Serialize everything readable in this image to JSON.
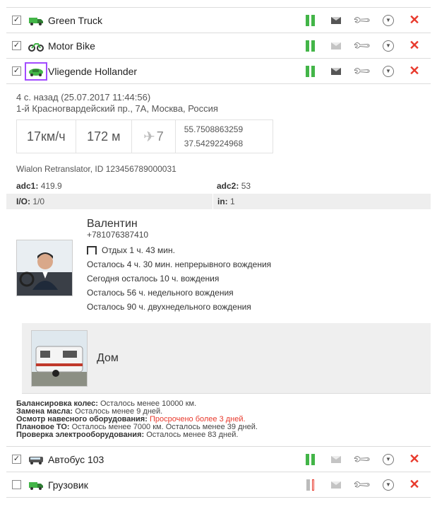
{
  "units": [
    {
      "name": "Green Truck",
      "checked": true,
      "icon": "truck-icon",
      "connection": "online"
    },
    {
      "name": "Motor Bike",
      "checked": true,
      "icon": "motorbike-icon",
      "connection": "online"
    },
    {
      "name": "Vliegende Hollander",
      "checked": true,
      "icon": "car-icon",
      "connection": "online"
    },
    {
      "name": "Автобус 103",
      "checked": true,
      "icon": "bus-icon",
      "connection": "online"
    },
    {
      "name": "Грузовик",
      "checked": false,
      "icon": "truck-icon",
      "connection": "offline"
    }
  ],
  "checkbox_mark": "✓",
  "details": {
    "last_message": "4 с. назад (25.07.2017 11:44:56)",
    "address": "1-й Красногвардейский пр., 7А, Москва, Россия",
    "speed": "17км/ч",
    "altitude": "172 м",
    "satellites": "7",
    "lat": "55.7508863259",
    "lon": "37.5429224968",
    "hardware": "Wialon Retranslator, ID 123456789000031",
    "params": [
      {
        "k1": "adc1:",
        "v1": "419.9",
        "k2": "adc2:",
        "v2": "53"
      },
      {
        "k1": "I/O:",
        "v1": "1/0",
        "k2": "in:",
        "v2": "1"
      }
    ]
  },
  "driver": {
    "name": "Валентин",
    "phone": "+781076387410",
    "rest": "Отдых 1 ч. 43 мин.",
    "lines": [
      "Осталось 4 ч. 30 мин. непрерывного вождения",
      "Сегодня осталось 10 ч. вождения",
      "Осталось 56 ч. недельного вождения",
      "Осталось 90 ч. двухнедельного вождения"
    ]
  },
  "trailer": {
    "name": "Дом"
  },
  "service": [
    {
      "label": "Балансировка колес:",
      "text": "Осталось менее 10000 км.",
      "overdue": false
    },
    {
      "label": "Замена масла:",
      "text": "Осталось менее 9 дней.",
      "overdue": false
    },
    {
      "label": "Осмотр навесного оборудования:",
      "text": "Просрочено более 3 дней.",
      "overdue": true
    },
    {
      "label": "Плановое ТО:",
      "text": "Осталось менее 7000 км. Осталось менее 39 дней.",
      "overdue": false
    },
    {
      "label": "Проверка электрооборудования:",
      "text": "Осталось менее 83 дней.",
      "overdue": false
    }
  ],
  "colors": {
    "online": "#43b548",
    "overdue": "#e8392c",
    "selection": "#a24bff"
  }
}
